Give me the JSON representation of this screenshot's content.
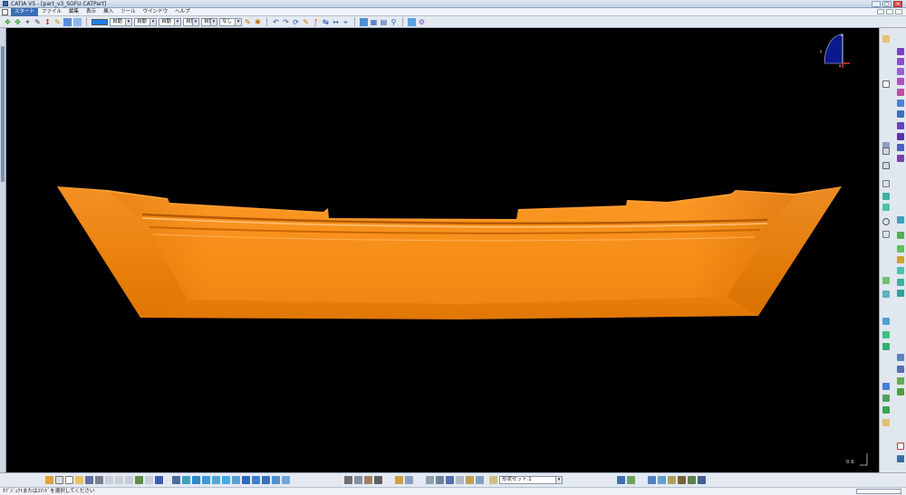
{
  "window": {
    "title": "CATIA V5 - [part_v3_SOFU.CATPart]",
    "buttons": [
      "_",
      "□",
      "×"
    ]
  },
  "menu": {
    "items": [
      "スタート",
      "ファイル",
      "編集",
      "表示",
      "挿入",
      "ツール",
      "ウインドウ",
      "ヘルプ"
    ]
  },
  "graphic_properties": {
    "fill_color": "#1c7ff0",
    "transparency": "自動",
    "line_thickness": "自動",
    "line_type": "自動",
    "point_symbol": "自動",
    "render_style": "自動",
    "layer": "なし"
  },
  "viewport": {
    "background": "#000000",
    "part_color": "#f28a10",
    "zoom_readout": "0.6",
    "compass_axes": [
      "x",
      "y",
      "z"
    ]
  },
  "bottom_toolbar": {
    "combo_value": "形状セット.1"
  },
  "status": {
    "message": "ｵﾌﾞｼﾞｪｸﾄまたはｺﾏﾝﾄﾞを選択してください",
    "command_input": ""
  }
}
